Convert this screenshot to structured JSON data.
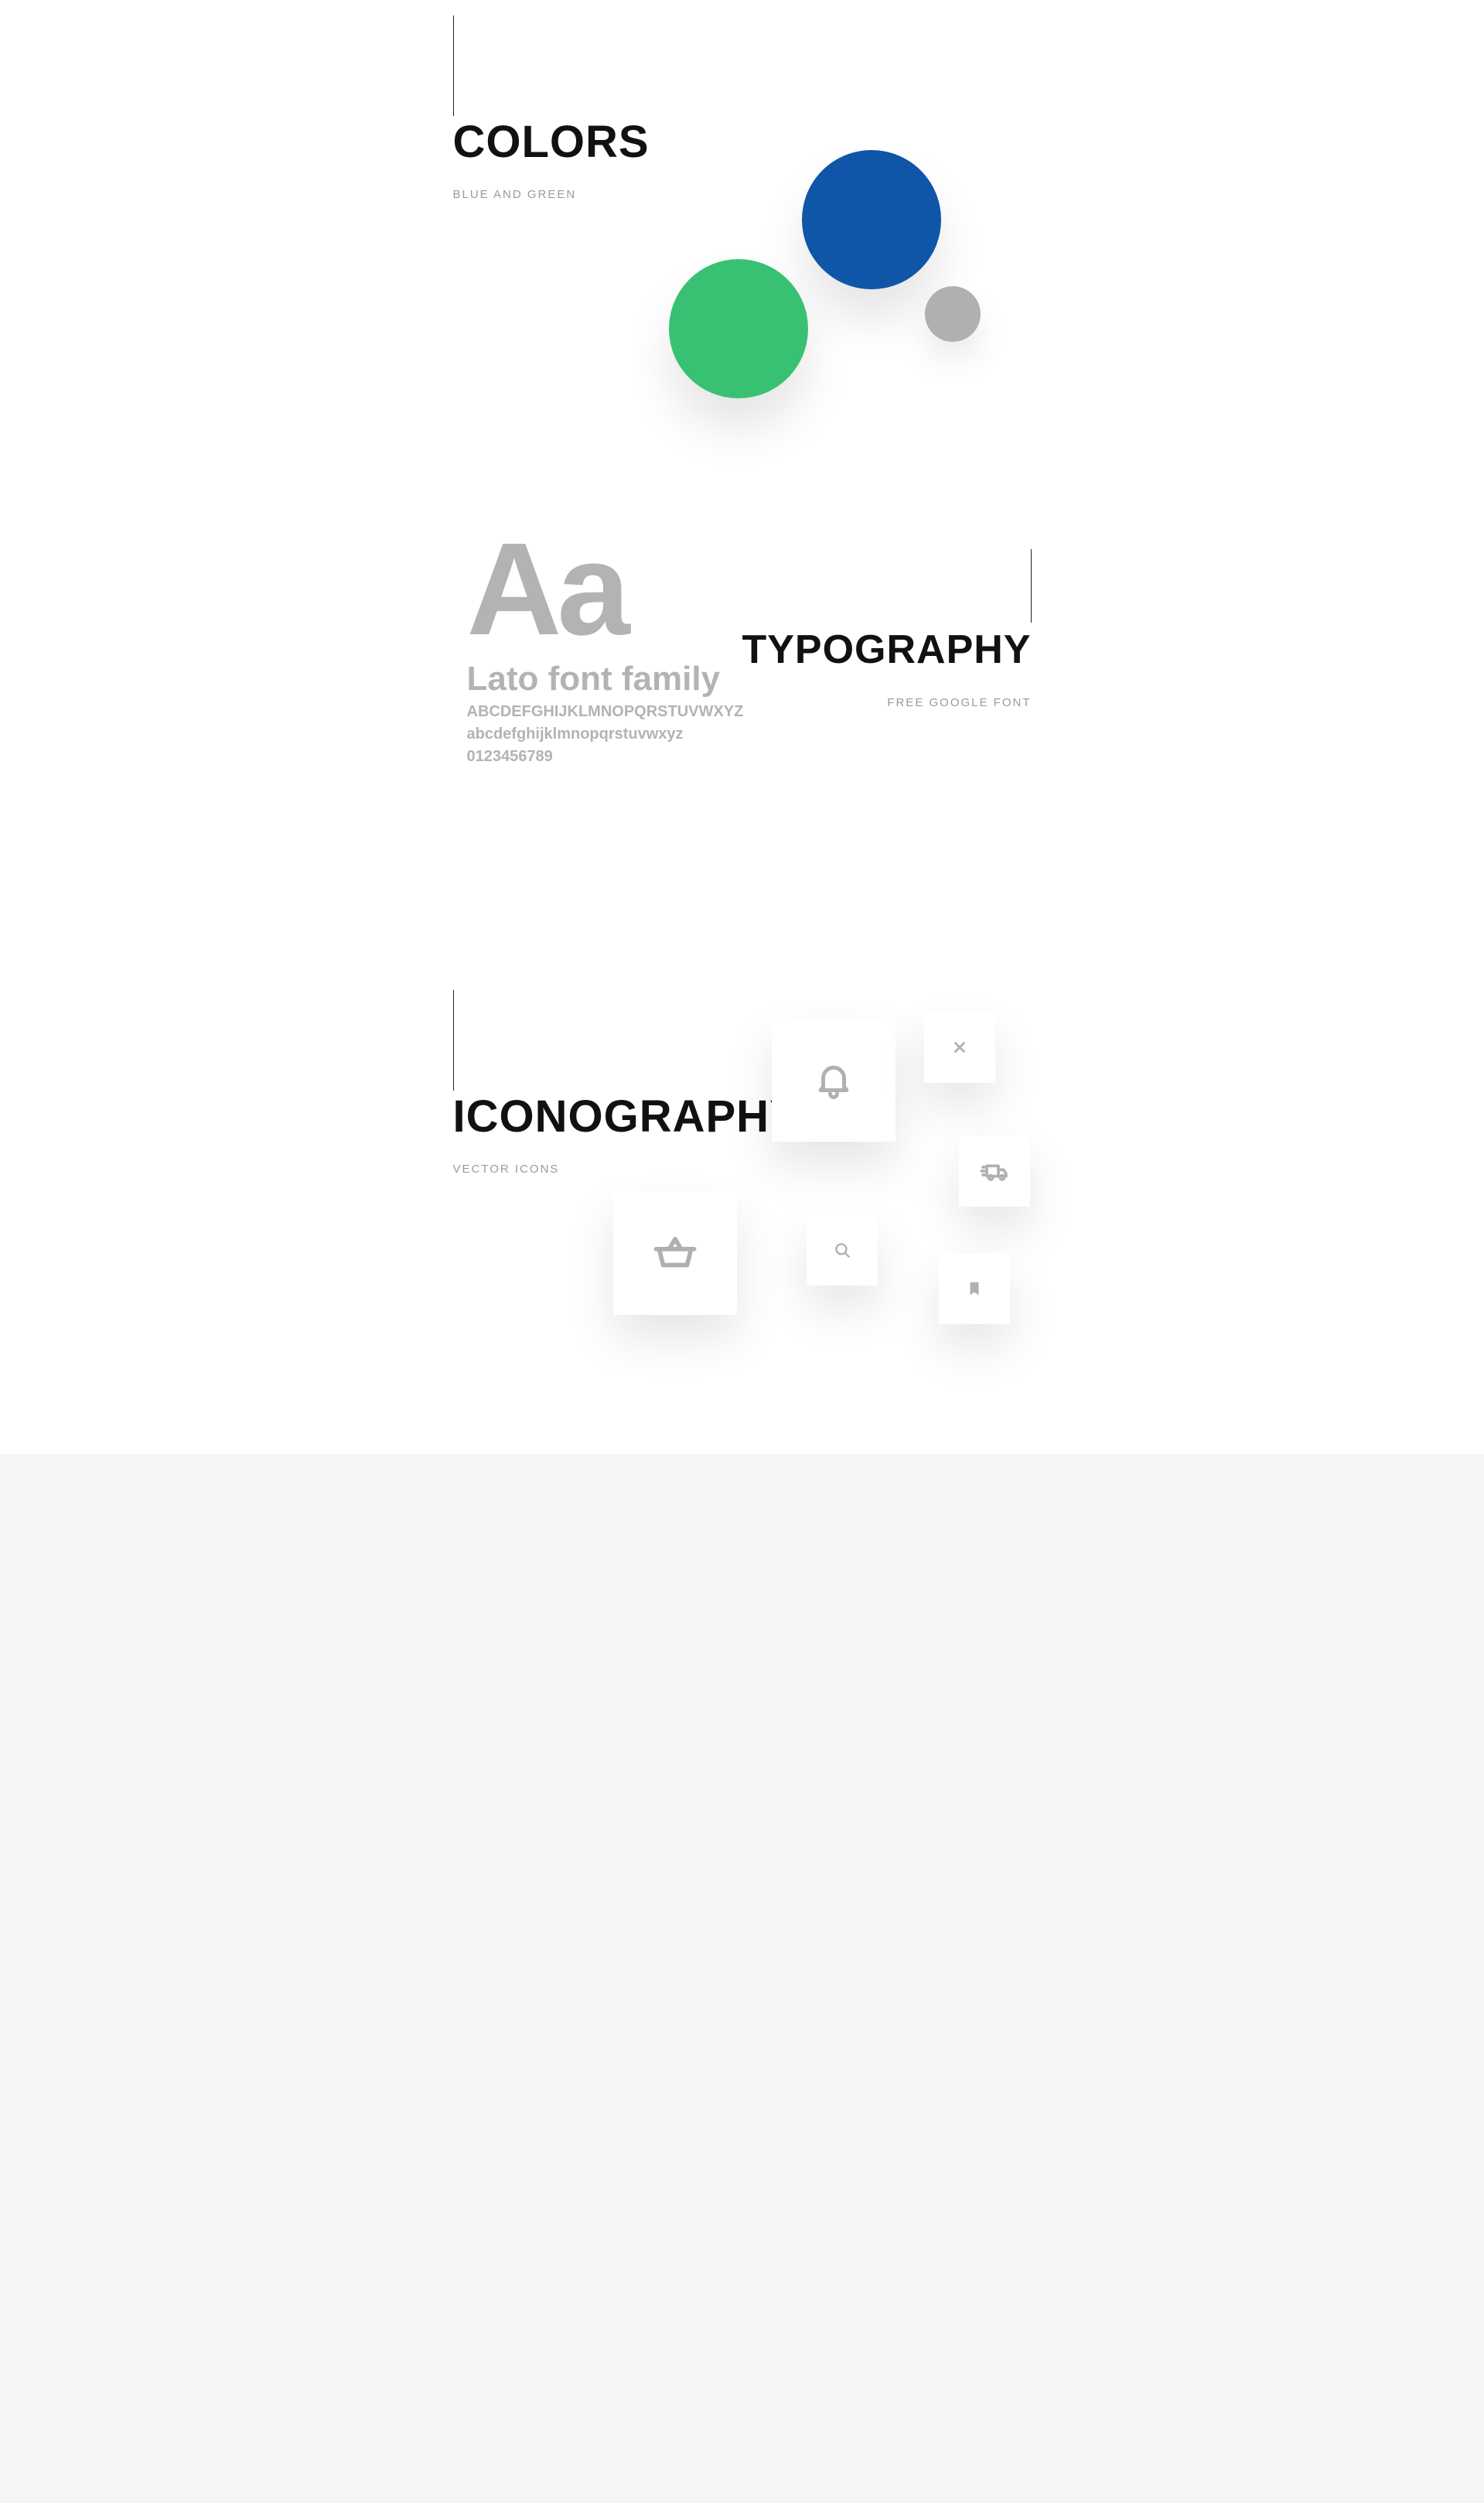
{
  "colors": {
    "title": "COLORS",
    "subtitle": "BLUE AND GREEN",
    "swatches": {
      "green": "#38c172",
      "blue": "#0f55a8",
      "grey": "#b0b0b0"
    }
  },
  "typography": {
    "title": "TYPOGRAPHY",
    "subtitle": "FREE GOOGLE FONT",
    "sample_big": "Aa",
    "family_name": "Lato font family",
    "glyphs_upper": "ABCDEFGHIJKLMNOPQRSTUVWXYZ",
    "glyphs_lower": "abcdefghijklmnopqrstuvwxyz",
    "glyphs_digits": "0123456789"
  },
  "iconography": {
    "title": "ICONOGRAPHY",
    "subtitle": "VECTOR ICONS",
    "icons": [
      "bell",
      "close",
      "truck",
      "basket",
      "search",
      "bookmark"
    ]
  }
}
